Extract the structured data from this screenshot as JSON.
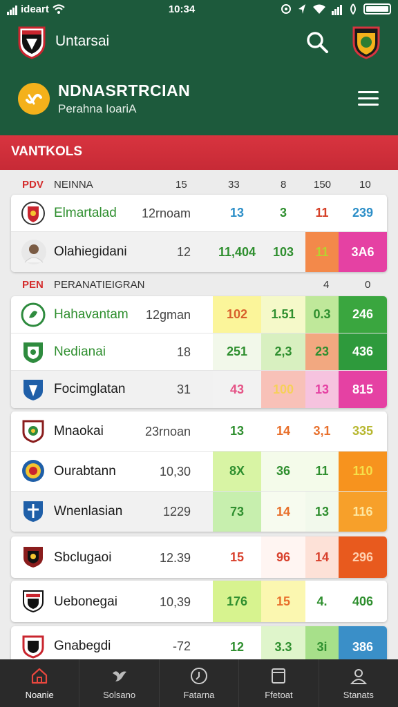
{
  "status": {
    "carrier": "ideart",
    "time": "10:34"
  },
  "header": {
    "title": "Untarsai",
    "brand_name": "NDNASRTRCIAN",
    "brand_subtitle": "Perahna IoariA"
  },
  "section": {
    "title": "VANTKOLS"
  },
  "col_header_1": {
    "code": "PDV",
    "label": "NEINNA",
    "c1": "15",
    "c2": "33",
    "c3": "8",
    "c4": "150",
    "c5": "10"
  },
  "col_header_2": {
    "code": "PEN",
    "label": "PERANATIEIGRAN",
    "c4": "4",
    "c5": "0"
  },
  "rows": [
    {
      "name": "Elmartalad",
      "meta": "12rnoam",
      "v1": "13",
      "v2": "3",
      "v3": "11",
      "v4": "239",
      "b1": "#ffffff",
      "b2": "#ffffff",
      "b3": "#ffffff",
      "b4": "#ffffff",
      "t1": "#2d8fc8",
      "t2": "#2f8f2f",
      "t3": "#d64027",
      "t4": "#2d8fc8"
    },
    {
      "name": "Olahiegidani",
      "meta": "12",
      "v1": "11,404",
      "v2": "103",
      "v3": "11",
      "v4": "3A6",
      "b1": "#f1f1f1",
      "b2": "#f1f1f1",
      "b3": "#f3894a",
      "b4": "#e541a3",
      "t1": "#2f8f2f",
      "t2": "#2f8f2f",
      "t3": "#b7d22f",
      "t4": "#ffffff"
    },
    {
      "name": "Hahavantam",
      "meta": "12gman",
      "v1": "102",
      "v2": "1.51",
      "v3": "0.3",
      "v4": "246",
      "b1": "#fbf59a",
      "b2": "#f5f9c9",
      "b3": "#bfe89a",
      "b4": "#3aa63f",
      "t1": "#d8602c",
      "t2": "#2f8f2f",
      "t3": "#2f8f2f",
      "t4": "#ffffff"
    },
    {
      "name": "Nedianai",
      "meta": "18",
      "v1": "251",
      "v2": "2,3",
      "v3": "23",
      "v4": "436",
      "b1": "#f2f8ea",
      "b2": "#d8f0c0",
      "b3": "#f2a880",
      "b4": "#2e9a3c",
      "t1": "#2f8f2f",
      "t2": "#2f8f2f",
      "t3": "#2f8f2f",
      "t4": "#ffffff"
    },
    {
      "name": "Focimglatan",
      "meta": "31",
      "v1": "43",
      "v2": "100",
      "v3": "13",
      "v4": "815",
      "b1": "#f2f2f2",
      "b2": "#f8c1b8",
      "b3": "#f6c3df",
      "b4": "#e541a3",
      "t1": "#e55487",
      "t2": "#f6d05a",
      "t3": "#e541a3",
      "t4": "#ffffff"
    },
    {
      "name": "Mnaokai",
      "meta": "23rnoan",
      "v1": "13",
      "v2": "14",
      "v3": "3,1",
      "v4": "335",
      "b1": "#ffffff",
      "b2": "#ffffff",
      "b3": "#ffffff",
      "b4": "#ffffff",
      "t1": "#2f8f2f",
      "t2": "#e8702c",
      "t3": "#e8702c",
      "t4": "#b7b72f"
    },
    {
      "name": "Ourabtann",
      "meta": "10,30",
      "v1": "8X",
      "v2": "36",
      "v3": "11",
      "v4": "110",
      "b1": "#d8f4a4",
      "b2": "#f4fbea",
      "b3": "#f4fbea",
      "b4": "#f7931e",
      "t1": "#2f8f2f",
      "t2": "#2f8f2f",
      "t3": "#2f8f2f",
      "t4": "#f6e04a"
    },
    {
      "name": "Wnenlasian",
      "meta": "1229",
      "v1": "73",
      "v2": "14",
      "v3": "13",
      "v4": "116",
      "b1": "#c7efae",
      "b2": "#f7fbef",
      "b3": "#f2f9ec",
      "b4": "#f7a02a",
      "t1": "#2f8f2f",
      "t2": "#e8702c",
      "t3": "#2f8f2f",
      "t4": "#fde7a0"
    },
    {
      "name": "Sbclugaoi",
      "meta": "12.39",
      "v1": "15",
      "v2": "96",
      "v3": "14",
      "v4": "296",
      "b1": "#ffffff",
      "b2": "#fff5f2",
      "b3": "#fde1d7",
      "b4": "#e85a1e",
      "t1": "#d8402c",
      "t2": "#d8402c",
      "t3": "#d8402c",
      "t4": "#ffd0b0"
    },
    {
      "name": "Uebonegai",
      "meta": "10,39",
      "v1": "176",
      "v2": "15",
      "v3": "4.",
      "v4": "406",
      "b1": "#d7f38f",
      "b2": "#fbf7b0",
      "b3": "#ffffff",
      "b4": "#ffffff",
      "t1": "#2f8f2f",
      "t2": "#e8702c",
      "t3": "#2f8f2f",
      "t4": "#2f8f2f"
    },
    {
      "name": "Gnabegdi",
      "meta": "-72",
      "v1": "12",
      "v2": "3.3",
      "v3": "3i",
      "v4": "386",
      "b1": "#ffffff",
      "b2": "#dff5cb",
      "b3": "#a7e08a",
      "b4": "#3a8fc8",
      "t1": "#2f8f2f",
      "t2": "#2f8f2f",
      "t3": "#2f8f2f",
      "t4": "#ffffff"
    }
  ],
  "nav": [
    {
      "label": "Noanie",
      "icon": "home-icon"
    },
    {
      "label": "Solsano",
      "icon": "bird-icon"
    },
    {
      "label": "Fatarna",
      "icon": "clock-icon"
    },
    {
      "label": "Ffetoat",
      "icon": "document-icon"
    },
    {
      "label": "Stanats",
      "icon": "user-icon"
    }
  ],
  "colors": {
    "primary": "#1d5a3c",
    "banner": "#d8343f",
    "accent": "#f4b11b",
    "nav_active": "#e8473e"
  }
}
